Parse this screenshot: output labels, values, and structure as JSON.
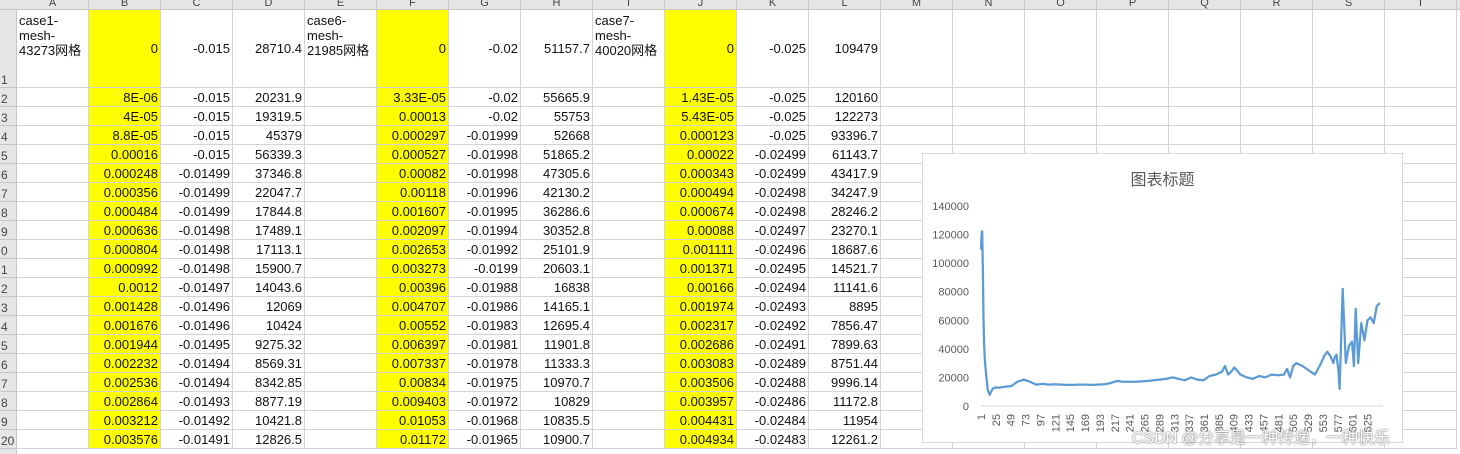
{
  "columns": [
    "A",
    "B",
    "C",
    "D",
    "E",
    "F",
    "G",
    "H",
    "I",
    "J",
    "K",
    "L",
    "M",
    "N",
    "O",
    "P",
    "Q",
    "R",
    "S",
    "T"
  ],
  "row_numbers": [
    "1",
    "2",
    "3",
    "4",
    "5",
    "6",
    "7",
    "8",
    "9",
    "0",
    "1",
    "2",
    "3",
    "4",
    "5",
    "6",
    "7",
    "8",
    "9",
    "20"
  ],
  "rows": [
    [
      "case1-mesh-43273网格",
      "0",
      "-0.015",
      "28710.4",
      "case6-mesh-21985网格",
      "0",
      "-0.02",
      "51157.7",
      "case7-mesh-40020网格",
      "0",
      "-0.025",
      "109479"
    ],
    [
      "",
      "8E-06",
      "-0.015",
      "20231.9",
      "",
      "3.33E-05",
      "-0.02",
      "55665.9",
      "",
      "1.43E-05",
      "-0.025",
      "120160"
    ],
    [
      "",
      "4E-05",
      "-0.015",
      "19319.5",
      "",
      "0.00013",
      "-0.02",
      "55753",
      "",
      "5.43E-05",
      "-0.025",
      "122273"
    ],
    [
      "",
      "8.8E-05",
      "-0.015",
      "45379",
      "",
      "0.000297",
      "-0.01999",
      "52668",
      "",
      "0.000123",
      "-0.025",
      "93396.7"
    ],
    [
      "",
      "0.00016",
      "-0.015",
      "56339.3",
      "",
      "0.000527",
      "-0.01998",
      "51865.2",
      "",
      "0.00022",
      "-0.02499",
      "61143.7"
    ],
    [
      "",
      "0.000248",
      "-0.01499",
      "37346.8",
      "",
      "0.00082",
      "-0.01998",
      "47305.6",
      "",
      "0.000343",
      "-0.02499",
      "43417.9"
    ],
    [
      "",
      "0.000356",
      "-0.01499",
      "22047.7",
      "",
      "0.00118",
      "-0.01996",
      "42130.2",
      "",
      "0.000494",
      "-0.02498",
      "34247.9"
    ],
    [
      "",
      "0.000484",
      "-0.01499",
      "17844.8",
      "",
      "0.001607",
      "-0.01995",
      "36286.6",
      "",
      "0.000674",
      "-0.02498",
      "28246.2"
    ],
    [
      "",
      "0.000636",
      "-0.01498",
      "17489.1",
      "",
      "0.002097",
      "-0.01994",
      "30352.8",
      "",
      "0.00088",
      "-0.02497",
      "23270.1"
    ],
    [
      "",
      "0.000804",
      "-0.01498",
      "17113.1",
      "",
      "0.002653",
      "-0.01992",
      "25101.9",
      "",
      "0.001111",
      "-0.02496",
      "18687.6"
    ],
    [
      "",
      "0.000992",
      "-0.01498",
      "15900.7",
      "",
      "0.003273",
      "-0.0199",
      "20603.1",
      "",
      "0.001371",
      "-0.02495",
      "14521.7"
    ],
    [
      "",
      "0.0012",
      "-0.01497",
      "14043.6",
      "",
      "0.00396",
      "-0.01988",
      "16838",
      "",
      "0.00166",
      "-0.02494",
      "11141.6"
    ],
    [
      "",
      "0.001428",
      "-0.01496",
      "12069",
      "",
      "0.004707",
      "-0.01986",
      "14165.1",
      "",
      "0.001974",
      "-0.02493",
      "8895"
    ],
    [
      "",
      "0.001676",
      "-0.01496",
      "10424",
      "",
      "0.00552",
      "-0.01983",
      "12695.4",
      "",
      "0.002317",
      "-0.02492",
      "7856.47"
    ],
    [
      "",
      "0.001944",
      "-0.01495",
      "9275.32",
      "",
      "0.006397",
      "-0.01981",
      "11901.8",
      "",
      "0.002686",
      "-0.02491",
      "7899.63"
    ],
    [
      "",
      "0.002232",
      "-0.01494",
      "8569.31",
      "",
      "0.007337",
      "-0.01978",
      "11333.3",
      "",
      "0.003083",
      "-0.02489",
      "8751.44"
    ],
    [
      "",
      "0.002536",
      "-0.01494",
      "8342.85",
      "",
      "0.00834",
      "-0.01975",
      "10970.7",
      "",
      "0.003506",
      "-0.02488",
      "9996.14"
    ],
    [
      "",
      "0.002864",
      "-0.01493",
      "8877.19",
      "",
      "0.009403",
      "-0.01972",
      "10829",
      "",
      "0.003957",
      "-0.02486",
      "11172.8"
    ],
    [
      "",
      "0.003212",
      "-0.01492",
      "10421.8",
      "",
      "0.01053",
      "-0.01968",
      "10835.5",
      "",
      "0.004431",
      "-0.02484",
      "11954"
    ],
    [
      "",
      "0.003576",
      "-0.01491",
      "12826.5",
      "",
      "0.01172",
      "-0.01965",
      "10900.7",
      "",
      "0.004934",
      "-0.02483",
      "12261.2"
    ]
  ],
  "highlight_color": "#ffff00",
  "chart_data": {
    "type": "line",
    "title": "图表标题",
    "xlabel": "",
    "ylabel": "",
    "ylim": [
      0,
      140000
    ],
    "yticks": [
      0,
      20000,
      40000,
      60000,
      80000,
      100000,
      120000,
      140000
    ],
    "xticks": [
      "1",
      "25",
      "49",
      "73",
      "97",
      "121",
      "145",
      "169",
      "193",
      "217",
      "241",
      "265",
      "289",
      "313",
      "337",
      "361",
      "385",
      "409",
      "433",
      "457",
      "481",
      "505",
      "529",
      "553",
      "577",
      "601",
      "625"
    ],
    "xlim": [
      1,
      650
    ],
    "grid": false,
    "legend": "none",
    "line_color": "#5b9bd5",
    "series": [
      {
        "x": [
          1,
          2,
          3,
          4,
          5,
          6,
          7,
          8,
          9,
          10,
          12,
          15,
          20,
          25,
          30,
          40,
          50,
          60,
          70,
          80,
          90,
          100,
          110,
          120,
          130,
          140,
          150,
          160,
          170,
          180,
          190,
          200,
          210,
          220,
          230,
          240,
          250,
          260,
          270,
          280,
          290,
          300,
          310,
          320,
          330,
          340,
          350,
          360,
          370,
          380,
          390,
          395,
          400,
          405,
          410,
          420,
          430,
          440,
          450,
          460,
          470,
          480,
          490,
          495,
          500,
          505,
          510,
          520,
          530,
          540,
          550,
          555,
          560,
          565,
          570,
          572,
          575,
          578,
          580,
          585,
          590,
          595,
          600,
          603,
          606,
          610,
          615,
          620,
          625,
          630,
          635,
          640,
          645
        ],
        "y": [
          109479,
          120160,
          122273,
          93396,
          61143,
          43417,
          34247,
          28246,
          23270,
          18687,
          11141,
          7856,
          12261,
          13000,
          12800,
          13500,
          14000,
          17000,
          18500,
          17000,
          15000,
          15500,
          15000,
          15200,
          15000,
          14800,
          14800,
          15000,
          15000,
          14800,
          15000,
          15200,
          16000,
          17500,
          17000,
          17000,
          17000,
          17200,
          17500,
          18000,
          18500,
          19000,
          20000,
          19000,
          18000,
          20000,
          18500,
          18000,
          21000,
          22000,
          24000,
          28000,
          22000,
          24000,
          27000,
          22000,
          20000,
          19000,
          21000,
          20000,
          22000,
          21500,
          22000,
          26000,
          20000,
          28000,
          30000,
          28000,
          25000,
          22000,
          30000,
          35000,
          38000,
          35000,
          30000,
          34000,
          36000,
          25000,
          12000,
          82000,
          30000,
          42000,
          45000,
          28000,
          68000,
          30000,
          58000,
          46000,
          60000,
          62000,
          58000,
          70000,
          72000
        ]
      }
    ]
  },
  "watermark": "CSDN @分享是一种传递，一种快乐"
}
